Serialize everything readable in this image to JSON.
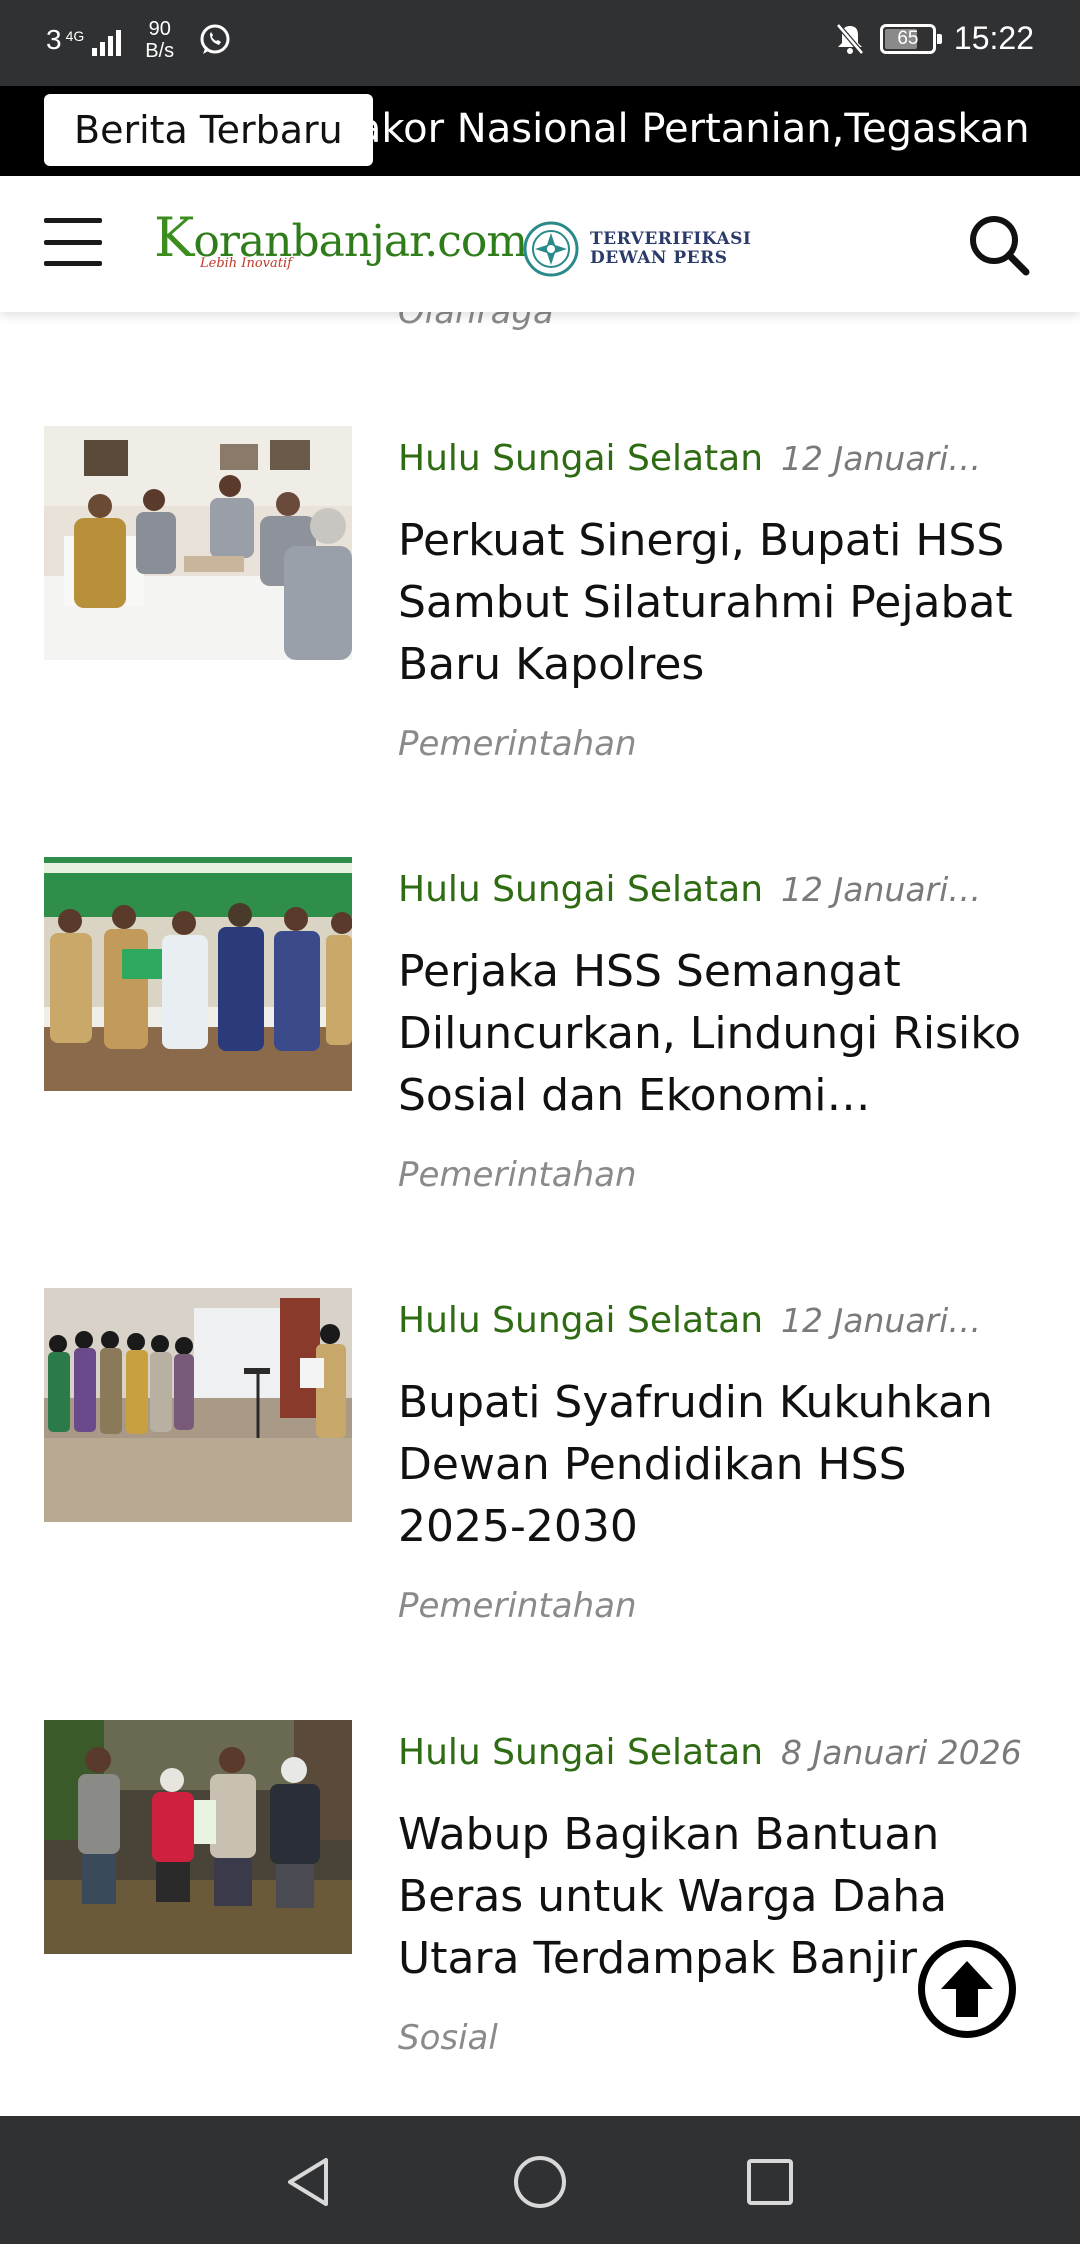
{
  "status_bar": {
    "network": "3",
    "network_gen": "4G",
    "speed_value": "90",
    "speed_unit": "B/s",
    "battery": "65",
    "time": "15:22"
  },
  "ticker": {
    "label": "Berita Terbaru",
    "headline": "Rakor Nasional Pertanian,Tegaskan"
  },
  "header": {
    "logo_text": "oranbanjar.com",
    "logo_initial": "K",
    "logo_tagline": "Lebih Inovatif",
    "badge_line1": "TERVERIFIKASI",
    "badge_line2": "DEWAN PERS"
  },
  "previous_category": "Olahraga",
  "articles": [
    {
      "region": "Hulu Sungai Selatan",
      "date": "12 Januari…",
      "title": "Perkuat Sinergi, Bupati HSS Sambut Silaturahmi Pejabat Baru Kapolres",
      "category": "Pemerintahan"
    },
    {
      "region": "Hulu Sungai Selatan",
      "date": "12 Januari…",
      "title": "Perjaka HSS Semangat Diluncurkan, Lindungi Risiko Sosial dan Ekonomi…",
      "category": "Pemerintahan"
    },
    {
      "region": "Hulu Sungai Selatan",
      "date": "12 Januari…",
      "title": "Bupati Syafrudin Kukuhkan Dewan Pendidikan HSS 2025-2030",
      "category": "Pemerintahan"
    },
    {
      "region": "Hulu Sungai Selatan",
      "date": "8 Januari 2026",
      "title": "Wabup Bagikan Bantuan Beras untuk Warga Daha Utara Terdampak Banjir",
      "category": "Sosial"
    }
  ],
  "colors": {
    "region_green": "#2e6b12",
    "status_bar": "#303133",
    "ticker_bg": "#000000"
  },
  "icons": {
    "menu": "hamburger-icon",
    "search": "search-icon",
    "scroll_top": "arrow-up-icon",
    "nav_back": "triangle-back-icon",
    "nav_home": "circle-home-icon",
    "nav_recents": "square-recents-icon"
  }
}
